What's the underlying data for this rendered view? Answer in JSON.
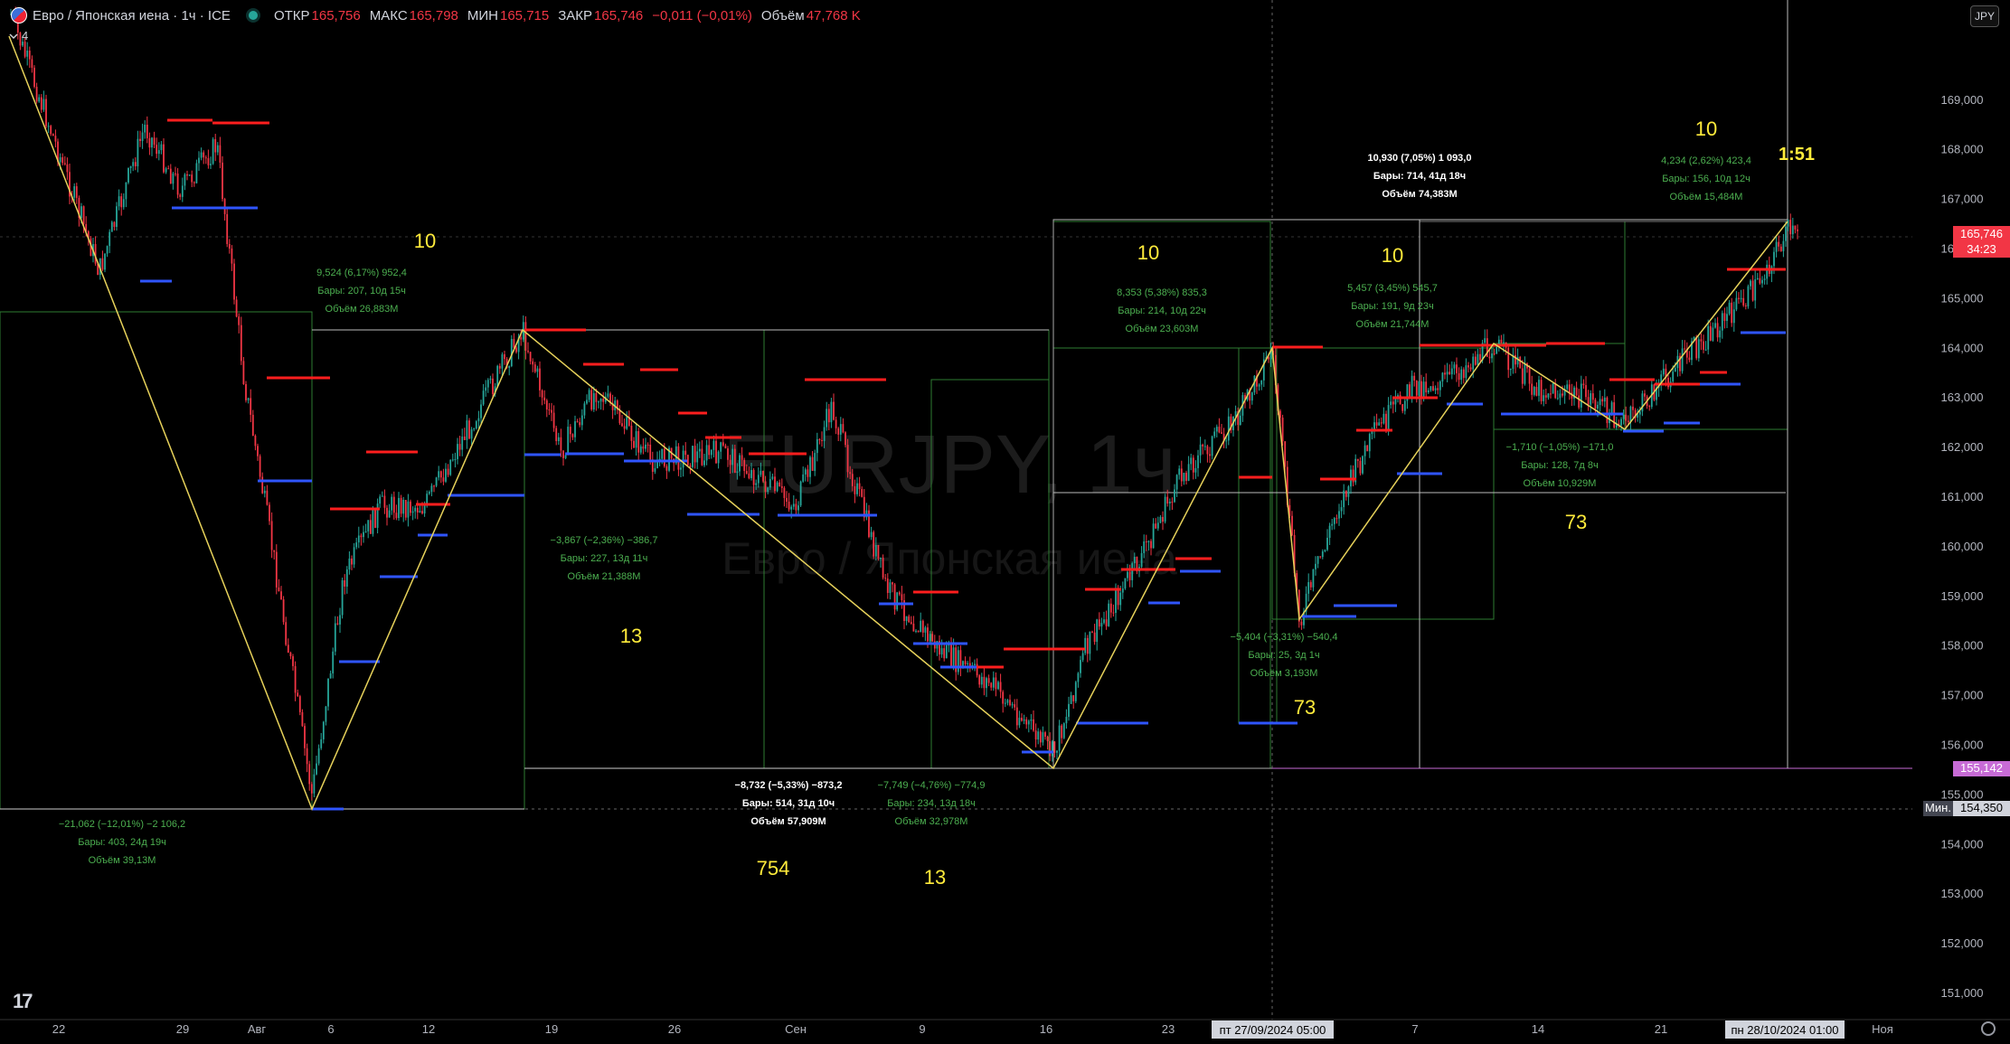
{
  "header": {
    "title": "Евро / Японская иена · 1ч · ICE",
    "open_label": "ОТКР",
    "open_value": "165,756",
    "high_label": "МАКС",
    "high_value": "165,798",
    "low_label": "МИН",
    "low_value": "165,715",
    "close_label": "ЗАКР",
    "close_value": "165,746",
    "change_value": "−0,011 (−0,01%)",
    "volume_label": "Объём",
    "volume_value": "47,768 K"
  },
  "indicator_count": "4",
  "currency_button": "JPY",
  "watermark": {
    "symbol": "EURJPY, 1ч",
    "name": "Евро / Японская иена"
  },
  "price_axis": {
    "ticks": [
      "169,000",
      "168,000",
      "167,000",
      "166,000",
      "165,000",
      "164,000",
      "163,000",
      "162,000",
      "161,000",
      "160,000",
      "159,000",
      "158,000",
      "157,000",
      "156,000",
      "155,000",
      "154,000",
      "153,000",
      "152,000",
      "151,000"
    ],
    "current_price": "165,746",
    "countdown": "34:23",
    "level_price": "155,142",
    "min_label": "Мин.",
    "min_price": "154,350"
  },
  "time_axis": {
    "ticks": [
      "22",
      "29",
      "Авг",
      "6",
      "12",
      "19",
      "26",
      "Сен",
      "9",
      "16",
      "23",
      "7",
      "14",
      "21",
      "Ноя"
    ],
    "cursor_label": "пт 27/09/2024   05:00",
    "cursor_label2": "пн 28/10/2024   01:00"
  },
  "numbers": [
    "10",
    "10",
    "10",
    "10",
    "13",
    "13",
    "754",
    "73",
    "73",
    "1:51"
  ],
  "measures": [
    {
      "l1": "−21,062 (−12,01%) −2 106,2",
      "l2": "Бары: 403, 24д 19ч",
      "l3": "Объём 39,13M"
    },
    {
      "l1": "9,524 (6,17%) 952,4",
      "l2": "Бары: 207, 10д 15ч",
      "l3": "Объём 26,883M"
    },
    {
      "l1": "−3,867 (−2,36%) −386,7",
      "l2": "Бары: 227, 13д 11ч",
      "l3": "Объём 21,388M"
    },
    {
      "l1": "−8,732 (−5,33%) −873,2",
      "l2": "Бары: 514, 31д 10ч",
      "l3": "Объём 57,909M"
    },
    {
      "l1": "−7,749 (−4,76%) −774,9",
      "l2": "Бары: 234, 13д 18ч",
      "l3": "Объём 32,978M"
    },
    {
      "l1": "8,353 (5,38%) 835,3",
      "l2": "Бары: 214, 10д 22ч",
      "l3": "Объём 23,603M"
    },
    {
      "l1": "10,930 (7,05%) 1 093,0",
      "l2": "Бары: 714, 41д 18ч",
      "l3": "Объём 74,383M"
    },
    {
      "l1": "5,457 (3,45%) 545,7",
      "l2": "Бары: 191, 9д 23ч",
      "l3": "Объём 21,744M"
    },
    {
      "l1": "−5,404 (−3,31%) −540,4",
      "l2": "Бары: 25, 3д 1ч",
      "l3": "Объём 3,193M"
    },
    {
      "l1": "−1,710 (−1,05%) −171,0",
      "l2": "Бары: 128, 7д 8ч",
      "l3": "Объём 10,929M"
    },
    {
      "l1": "4,234 (2,62%) 423,4",
      "l2": "Бары: 156, 10д 12ч",
      "l3": "Объём 15,484M"
    }
  ],
  "colors": {
    "up": "#26a69a",
    "down": "#f23645",
    "resistance": "#ff1e1e",
    "support": "#2f55ff",
    "zigzag": "#e6d15a",
    "measure": "#4caf50",
    "label_yellow": "#ffeb3b",
    "level": "#c76bd6"
  }
}
